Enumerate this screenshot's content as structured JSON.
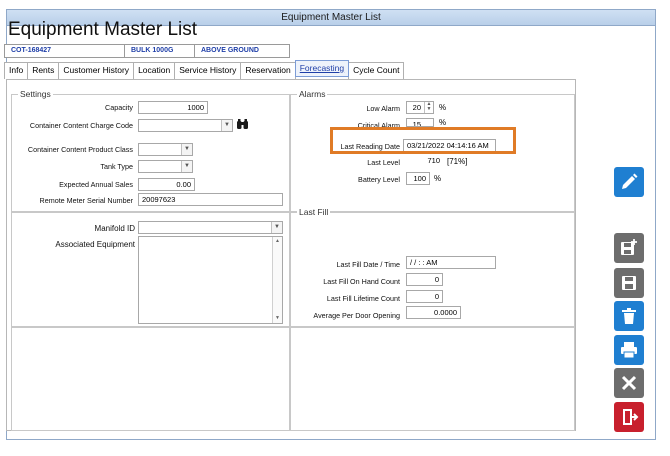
{
  "window": {
    "title": "Equipment Master List"
  },
  "header": {
    "title": "Equipment Master List"
  },
  "infobar": {
    "id": "COT-168427",
    "type": "BULK 1000G",
    "location": "ABOVE GROUND"
  },
  "tabs": [
    {
      "label": "Info"
    },
    {
      "label": "Rents"
    },
    {
      "label": "Customer History"
    },
    {
      "label": "Location"
    },
    {
      "label": "Service History"
    },
    {
      "label": "Reservation"
    },
    {
      "label": "Forecasting"
    },
    {
      "label": "Cycle Count"
    }
  ],
  "settings": {
    "legend": "Settings",
    "capacity_label": "Capacity",
    "capacity_value": "1000",
    "charge_code_label": "Container Content Charge Code",
    "charge_code_value": "",
    "product_class_label": "Container Content Product Class",
    "product_class_value": "",
    "tank_type_label": "Tank Type",
    "tank_type_value": "",
    "annual_sales_label": "Expected Annual Sales",
    "annual_sales_value": "0.00",
    "meter_serial_label": "Remote Meter Serial Number",
    "meter_serial_value": "20097623",
    "manifold_label": "Manifold ID",
    "manifold_value": "",
    "assoc_equipment_label": "Associated Equipment"
  },
  "alarms": {
    "legend": "Alarms",
    "low_alarm_label": "Low Alarm",
    "low_alarm_value": "20",
    "low_alarm_unit": "%",
    "critical_alarm_label": "Critical Alarm",
    "critical_alarm_value": "15",
    "critical_alarm_unit": "%",
    "last_reading_label": "Last Reading Date",
    "last_reading_value": "03/21/2022 04:14:16 AM",
    "last_level_label": "Last Level",
    "last_level_value": "710",
    "last_level_pct": "[71%]",
    "battery_label": "Battery Level",
    "battery_value": "100",
    "battery_unit": "%"
  },
  "last_fill": {
    "legend": "Last Fill",
    "date_label": "Last Fill Date / Time",
    "date_value": "/ /        :  :   AM",
    "on_hand_label": "Last Fill On Hand Count",
    "on_hand_value": "0",
    "lifetime_label": "Last Fill Lifetime Count",
    "lifetime_value": "0",
    "avg_door_label": "Average Per Door Opening",
    "avg_door_value": "0.0000"
  },
  "colors": {
    "accent": "#1f3fa8",
    "highlight": "#e07b26",
    "sidebar_blue": "#1f7fd1",
    "sidebar_gray": "#6d6d6d",
    "sidebar_red": "#c8202d"
  }
}
